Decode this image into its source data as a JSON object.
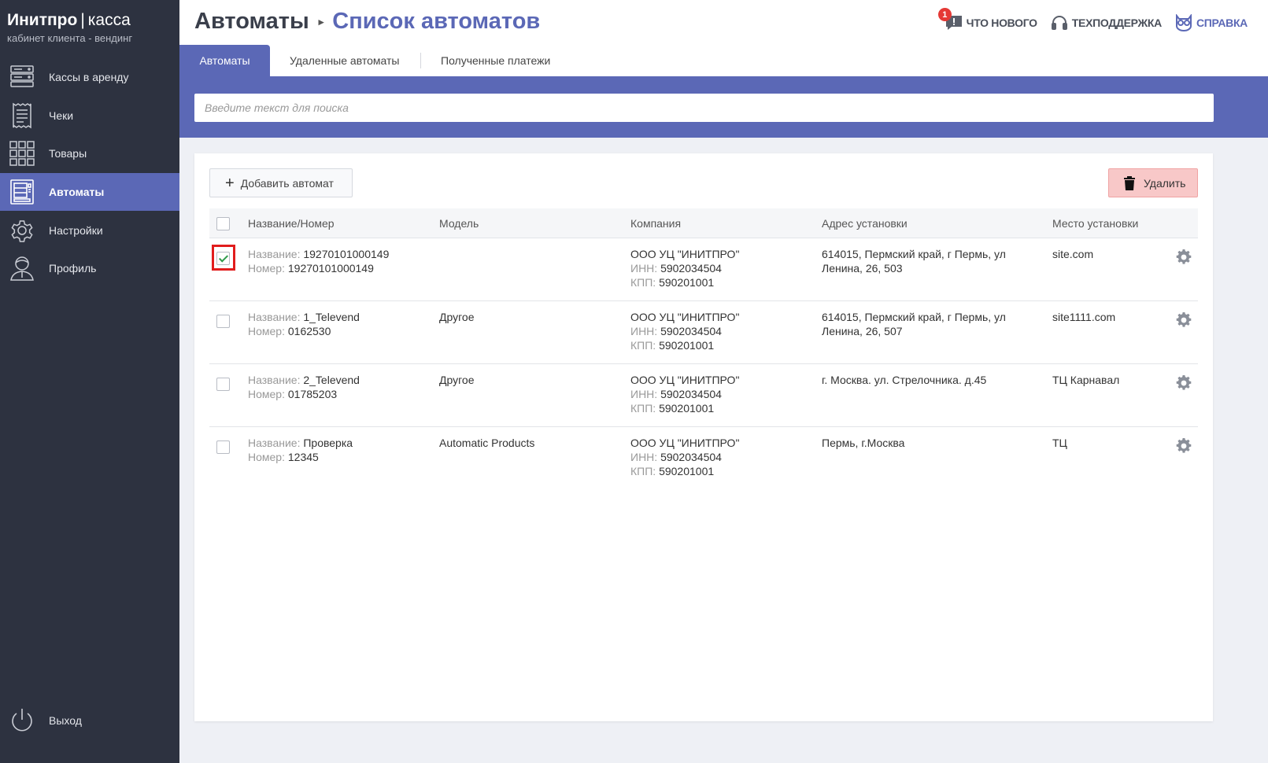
{
  "sidebar": {
    "brand_name": "Инитпро",
    "brand_sep": "|",
    "brand_product": "касса",
    "brand_subtitle": "кабинет клиента - вендинг",
    "items": [
      {
        "label": "Кассы в аренду",
        "icon": "server-icon"
      },
      {
        "label": "Чеки",
        "icon": "receipt-icon"
      },
      {
        "label": "Товары",
        "icon": "grid-icon"
      },
      {
        "label": "Автоматы",
        "icon": "vending-machine-icon",
        "active": true
      },
      {
        "label": "Настройки",
        "icon": "gear-icon"
      },
      {
        "label": "Профиль",
        "icon": "user-icon"
      }
    ],
    "logout_label": "Выход"
  },
  "header": {
    "breadcrumb_root": "Автоматы",
    "breadcrumb_arrow": "▸",
    "page_title": "Список автоматов",
    "whats_new_label": "ЧТО НОВОГО",
    "whats_new_badge": "1",
    "support_label": "ТЕХПОДДЕРЖКА",
    "help_label": "СПРАВКА"
  },
  "tabs": [
    {
      "label": "Автоматы",
      "active": true
    },
    {
      "label": "Удаленные автоматы"
    },
    {
      "label": "Полученные платежи"
    }
  ],
  "search": {
    "placeholder": "Введите текст для поиска",
    "value": ""
  },
  "toolbar": {
    "add_label": "Добавить автомат",
    "add_plus": "+",
    "delete_label": "Удалить"
  },
  "table": {
    "columns": [
      "Название/Номер",
      "Модель",
      "Компания",
      "Адрес установки",
      "Место установки"
    ],
    "name_prefix": "Название:",
    "number_prefix": "Номер:",
    "inn_prefix": "ИНН:",
    "kpp_prefix": "КПП:",
    "rows": [
      {
        "checked": true,
        "name": "19270101000149",
        "number": "19270101000149",
        "model": "",
        "company": "ООО УЦ \"ИНИТПРО\"",
        "inn": "5902034504",
        "kpp": "590201001",
        "address": "614015, Пермский край, г Пермь, ул Ленина, 26, 503",
        "place": "site.com"
      },
      {
        "checked": false,
        "name": "1_Televend",
        "number": "0162530",
        "model": "Другое",
        "company": "ООО УЦ \"ИНИТПРО\"",
        "inn": "5902034504",
        "kpp": "590201001",
        "address": "614015, Пермский край, г Пермь, ул Ленина, 26, 507",
        "place": "site1111.com"
      },
      {
        "checked": false,
        "name": "2_Televend",
        "number": "01785203",
        "model": "Другое",
        "company": "ООО УЦ \"ИНИТПРО\"",
        "inn": "5902034504",
        "kpp": "590201001",
        "address": "г. Москва. ул. Стрелочника. д.45",
        "place": "ТЦ Карнавал"
      },
      {
        "checked": false,
        "name": "Проверка",
        "number": "12345",
        "model": "Automatic Products",
        "company": "ООО УЦ \"ИНИТПРО\"",
        "inn": "5902034504",
        "kpp": "590201001",
        "address": "Пермь, г.Москва",
        "place": "ТЦ"
      }
    ]
  },
  "colors": {
    "accent": "#5b68b6",
    "sidebar_bg": "#2d3240",
    "danger_bg": "#f8c8c8",
    "highlight": "#e11d1d"
  }
}
